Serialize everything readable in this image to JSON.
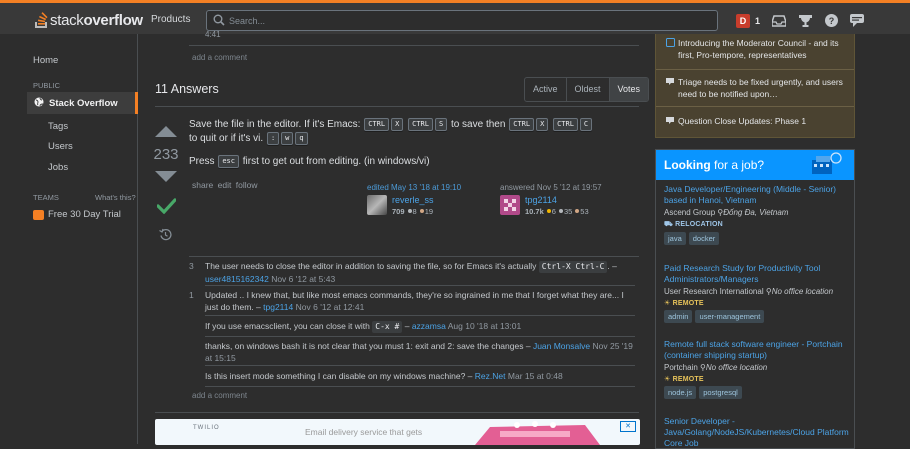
{
  "topbar": {
    "logo_a": "stack",
    "logo_b": "overflow",
    "products": "Products",
    "search_placeholder": "Search...",
    "user_initial": "D",
    "reputation": "1"
  },
  "leftnav": {
    "home": "Home",
    "public": "PUBLIC",
    "stack_overflow": "Stack Overflow",
    "tags": "Tags",
    "users": "Users",
    "jobs": "Jobs",
    "teams": "TEAMS",
    "whats_this": "What's this?",
    "trial": "Free 30 Day Trial"
  },
  "question": {
    "prev_timestamp": "4:41",
    "add_comment": "add a comment"
  },
  "answers": {
    "title": "11 Answers",
    "sort_tabs": [
      "Active",
      "Oldest",
      "Votes"
    ],
    "active_tab": "Votes"
  },
  "answer": {
    "votes": "233",
    "line1_a": "Save the file in the editor. If it's Emacs:",
    "line1_b": "to save then",
    "line2_a": "to quit or if it's vi.",
    "keys_save": [
      "CTRL",
      "X",
      "CTRL",
      "S"
    ],
    "keys_quit": [
      "CTRL",
      "X",
      "CTRL",
      "C"
    ],
    "keys_vi": [
      ":",
      "w",
      "q"
    ],
    "line3_a": "Press",
    "key_esc": "esc",
    "line3_b": "first to get out from editing. (in windows/vi)",
    "share": "share",
    "edit": "edit",
    "follow": "follow",
    "edited_label": "edited May 13 '18 at 19:10",
    "editor_name": "reverle_ss",
    "editor_rep": "709",
    "editor_silver": "8",
    "editor_bronze": "19",
    "answered_label": "answered Nov 5 '12 at 19:57",
    "author_name": "tpg2114",
    "author_rep": "10.7k",
    "author_gold": "6",
    "author_silver": "35",
    "author_bronze": "53"
  },
  "comments": [
    {
      "score": "3",
      "text": "The user needs to close the editor in addition to saving the file, so for Emacs it's actually",
      "code": "Ctrl-X Ctrl-C",
      "sep": ".  –",
      "user": "user4815162342",
      "date": "Nov 6 '12 at 5:43"
    },
    {
      "score": "1",
      "text": "Updated .. I knew that, but like most emacs commands, they're so ingrained in me that I forget what they are... I just do them. –",
      "user": "tpg2114",
      "date": "Nov 6 '12 at 12:41"
    },
    {
      "score": "",
      "text": "If you use emacsclient, you can close it with",
      "code": "C-x #",
      "sep": " –",
      "user": "azzamsa",
      "date": "Aug 10 '18 at 13:01"
    },
    {
      "score": "",
      "text": "thanks, on windows bash it is not clear that you must 1: exit and 2: save the changes –",
      "user": "Juan Monsalve",
      "date": "Nov 25 '19 at 15:15"
    },
    {
      "score": "",
      "text": "Is this insert mode something I can disable on my windows machine? –",
      "user": "Rez.Net",
      "date": "Mar 15 at 0:48"
    }
  ],
  "bottom_add_comment": "add a comment",
  "ad": {
    "brand": "TWILIO",
    "text": "Email delivery service that gets"
  },
  "sidebar": {
    "mod_items": [
      "Introducing the Moderator Council - and its first, Pro-tempore, representatives",
      "Triage needs to be fixed urgently, and users need to be notified upon…",
      "Question Close Updates: Phase 1"
    ],
    "jobs_title_a": "Looking",
    "jobs_title_b": "for a job?",
    "jobs": [
      {
        "title": "Java Developer/Engineering (Middle - Senior) based in Hanoi, Vietnam",
        "company": "Ascend Group",
        "location": "Đống Đa, Vietnam",
        "perk": "RELOCATION",
        "perk_color": "#9fc6e8",
        "tags": [
          "java",
          "docker"
        ]
      },
      {
        "title": "Paid Research Study for Productivity Tool Administrators/Managers",
        "company": "User Research International",
        "location": "No office location",
        "perk": "REMOTE",
        "perk_color": "#e6c25a",
        "tags": [
          "admin",
          "user-management"
        ]
      },
      {
        "title": "Remote full stack software engineer - Portchain (container shipping startup)",
        "company": "Portchain",
        "location": "No office location",
        "perk": "REMOTE",
        "perk_color": "#e6c25a",
        "tags": [
          "node.js",
          "postgresql"
        ]
      },
      {
        "title": "Senior Developer - Java/Golang/NodeJS/Kubernetes/Cloud Platform Core Job",
        "company": "",
        "location": "",
        "perk": "",
        "perk_color": "",
        "tags": []
      }
    ]
  },
  "colors": {
    "accent": "#f48024",
    "link": "#4ca3e6",
    "jobs_header": "#0a95ff",
    "mod_bg": "#4a4230"
  }
}
